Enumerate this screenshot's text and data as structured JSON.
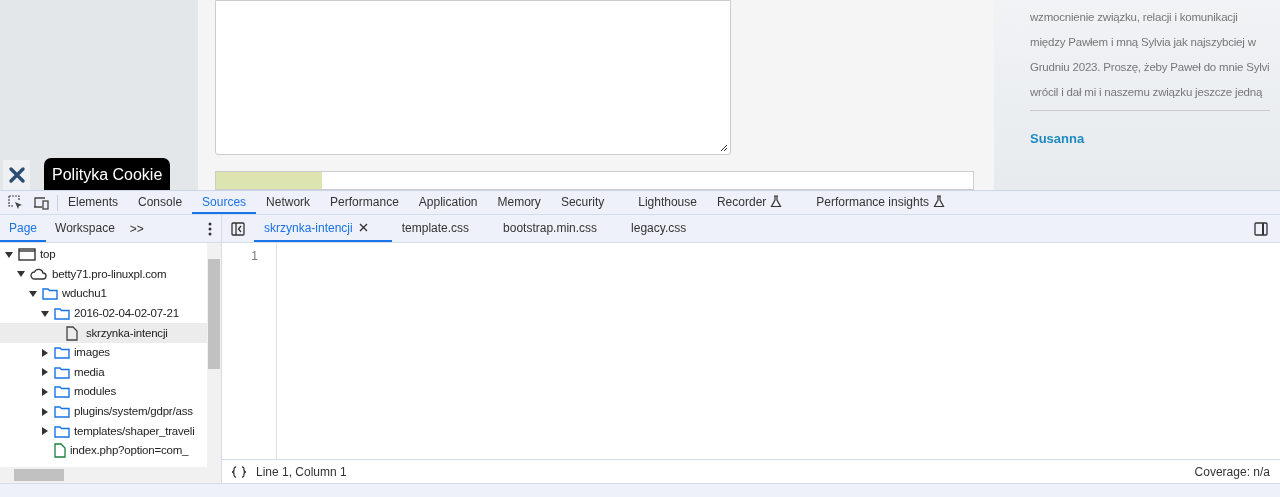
{
  "page": {
    "cookie_badge": "Polityka Cookie",
    "comment_text": "wzmocnienie związku, relacji i komunikacji między Pawłem i mną Sylvia jak najszybciej w Grudniu 2023. Proszę, żeby Paweł do mnie Sylvi wrócil i dał mi i naszemu związku jeszcze jedną",
    "next_author": "Susanna"
  },
  "devtools": {
    "tabs": [
      {
        "label": "Elements",
        "selected": false,
        "experimental": false
      },
      {
        "label": "Console",
        "selected": false,
        "experimental": false
      },
      {
        "label": "Sources",
        "selected": true,
        "experimental": false
      },
      {
        "label": "Network",
        "selected": false,
        "experimental": false
      },
      {
        "label": "Performance",
        "selected": false,
        "experimental": false
      },
      {
        "label": "Application",
        "selected": false,
        "experimental": false
      },
      {
        "label": "Memory",
        "selected": false,
        "experimental": false
      },
      {
        "label": "Security",
        "selected": false,
        "experimental": false
      },
      {
        "label": "Lighthouse",
        "selected": false,
        "experimental": false
      },
      {
        "label": "Recorder",
        "selected": false,
        "experimental": true
      },
      {
        "label": "Performance insights",
        "selected": false,
        "experimental": true
      }
    ],
    "navigator_tabs": [
      {
        "label": "Page",
        "selected": true
      },
      {
        "label": "Workspace",
        "selected": false
      }
    ],
    "more_tabs": ">>",
    "tree": [
      {
        "kind": "frame",
        "label": "top",
        "expanded": true,
        "selected": false,
        "children": [
          {
            "kind": "domain",
            "label": "betty71.pro-linuxpl.com",
            "expanded": true,
            "selected": false,
            "children": [
              {
                "kind": "folder",
                "label": "wduchu1",
                "expanded": true,
                "selected": false,
                "children": [
                  {
                    "kind": "folder",
                    "label": "2016-02-04-02-07-21",
                    "expanded": true,
                    "selected": false,
                    "children": [
                      {
                        "kind": "file",
                        "label": "skrzynka-intencji",
                        "selected": true
                      }
                    ]
                  },
                  {
                    "kind": "folder",
                    "label": "images",
                    "expanded": false,
                    "selected": false
                  },
                  {
                    "kind": "folder",
                    "label": "media",
                    "expanded": false,
                    "selected": false
                  },
                  {
                    "kind": "folder",
                    "label": "modules",
                    "expanded": false,
                    "selected": false
                  },
                  {
                    "kind": "folder",
                    "label": "plugins/system/gdpr/ass",
                    "expanded": false,
                    "selected": false
                  },
                  {
                    "kind": "folder",
                    "label": "templates/shaper_traveli",
                    "expanded": false,
                    "selected": false
                  },
                  {
                    "kind": "script",
                    "label": "index.php?option=com_",
                    "selected": false
                  }
                ]
              }
            ]
          }
        ]
      }
    ],
    "editor_tabs": [
      {
        "label": "skrzynka-intencji",
        "selected": true,
        "closable": true
      },
      {
        "label": "template.css",
        "selected": false,
        "closable": false
      },
      {
        "label": "bootstrap.min.css",
        "selected": false,
        "closable": false
      },
      {
        "label": "legacy.css",
        "selected": false,
        "closable": false
      }
    ],
    "line_numbers": [
      "1"
    ],
    "status_bar": {
      "position": "Line 1, Column 1",
      "coverage": "Coverage: n/a"
    }
  }
}
